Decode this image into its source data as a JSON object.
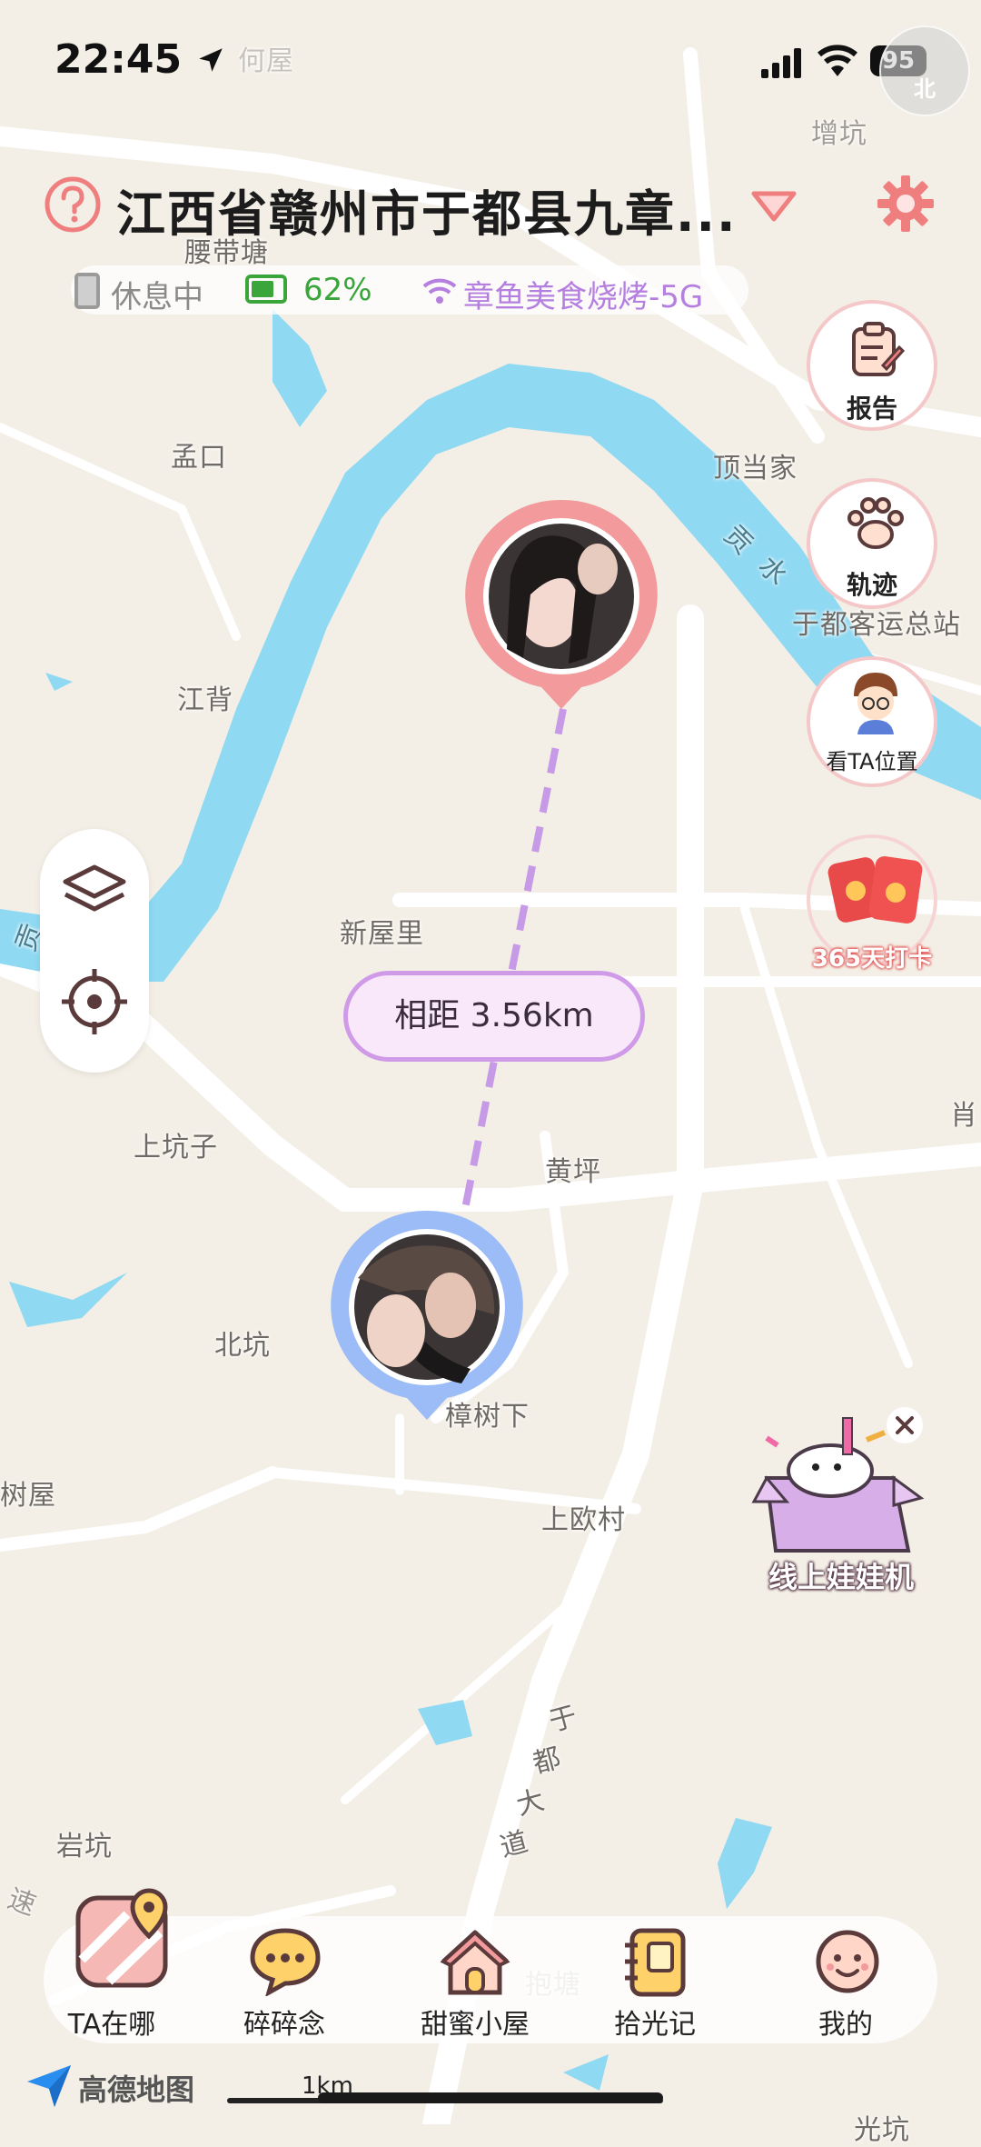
{
  "status_bar": {
    "time": "22:45",
    "battery": "95",
    "compass": "北"
  },
  "header": {
    "address": "江西省赣州市于都县九章...",
    "device_state": "休息中",
    "battery_percent": "62%",
    "wifi_name": "章鱼美食烧烤-5G"
  },
  "side_buttons": {
    "report": "报告",
    "track": "轨迹",
    "see_location": "看TA位置",
    "checkin": "365天打卡"
  },
  "distance_label": "相距 3.56km",
  "promo": {
    "label": "线上娃娃机"
  },
  "map_places": {
    "p1": "何屋",
    "p2": "增坑",
    "p3": "腰带塘",
    "p4": "孟口",
    "p5": "顶当家",
    "p6": "于都客运总站",
    "p7": "江背",
    "p8": "新屋里",
    "p9": "上坑子",
    "p10": "黄坪",
    "p11": "北坑",
    "p12": "樟树下",
    "p13": "上欧村",
    "p14": "树屋",
    "p15": "岩坑",
    "p16": "抱塘",
    "p17": "肖",
    "p18": "光坑",
    "p19": "贡",
    "p20": "速",
    "road": [
      "于",
      "都",
      "大",
      "道"
    ],
    "river": [
      "贡",
      "水"
    ]
  },
  "nav": [
    {
      "label": "TA在哪"
    },
    {
      "label": "碎碎念"
    },
    {
      "label": "甜蜜小屋"
    },
    {
      "label": "拾光记"
    },
    {
      "label": "我的"
    }
  ],
  "map_footer": {
    "logo": "高德地图",
    "scale": "1km"
  },
  "colors": {
    "river": "#8fd9f2",
    "road": "#ffffff",
    "pink_pin": "#f29a9c",
    "blue_pin": "#9cbcf7",
    "route": "#c79ae8"
  }
}
